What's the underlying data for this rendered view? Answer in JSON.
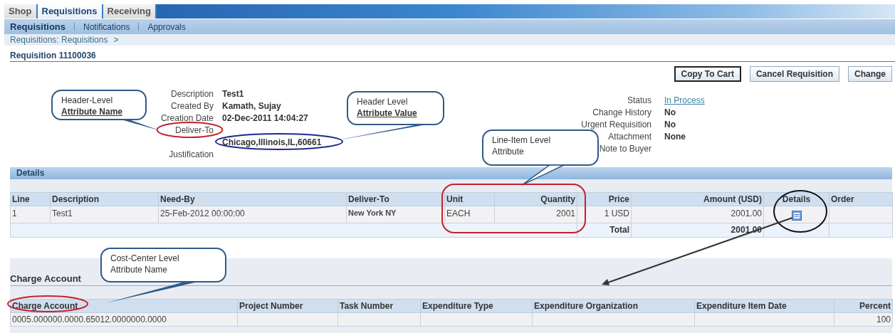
{
  "tabs": [
    {
      "label": "Shop",
      "selected": false
    },
    {
      "label": "Requisitions",
      "selected": true
    },
    {
      "label": "Receiving",
      "selected": false
    }
  ],
  "subtabs": [
    {
      "label": "Requisitions",
      "selected": true
    },
    {
      "label": "Notifications",
      "selected": false
    },
    {
      "label": "Approvals",
      "selected": false
    }
  ],
  "breadcrumb": {
    "link": "Requisitions: Requisitions",
    "separator": ">"
  },
  "title": "Requisition 11100036",
  "buttons": [
    {
      "label": "Copy To Cart",
      "focused": true
    },
    {
      "label": "Cancel Requisition",
      "focused": false
    },
    {
      "label": "Change",
      "focused": false
    }
  ],
  "header_left": [
    {
      "label": "Description",
      "value": "Test1"
    },
    {
      "label": "Created By",
      "value": "Kamath, Sujay"
    },
    {
      "label": "Creation Date",
      "value": "02-Dec-2011 14:04:27"
    },
    {
      "label": "Deliver-To"
    },
    {
      "value": "Chicago,Illinois,IL,60661"
    },
    {
      "label": "Justification"
    }
  ],
  "header_right": [
    {
      "label": "Status",
      "value": "In Process",
      "kind": "link"
    },
    {
      "label": "Change History",
      "value": "No",
      "kind": "text"
    },
    {
      "label": "Urgent Requisition",
      "value": "No",
      "kind": "text"
    },
    {
      "label": "Attachment",
      "value": "None",
      "kind": "text"
    },
    {
      "label": "Note to Buyer"
    }
  ],
  "details": {
    "title": "Details",
    "columns": [
      "Line",
      "Description",
      "Need-By",
      "Deliver-To",
      "Unit",
      "Quantity",
      "Price",
      "Amount (USD)",
      "Details",
      "Order"
    ],
    "rows": [
      {
        "cells": [
          "1",
          "Test1",
          "25-Feb-2012 00:00:00",
          "New York NY",
          "EACH",
          "2001",
          "1 USD",
          "2001.00"
        ]
      }
    ],
    "total_label": "Total",
    "total": "2001.00"
  },
  "charge_account": {
    "title": "Charge Account",
    "columns": [
      "Charge Account",
      "Project Number",
      "Task Number",
      "Expenditure Type",
      "Expenditure Organization",
      "Expenditure Item Date",
      "Percent"
    ],
    "rows": [
      [
        "0005.000000.0000.65012.0000000.0000",
        "",
        "",
        "",
        "",
        "",
        "100"
      ]
    ]
  },
  "callouts": [
    {
      "text": "Header-Level **Attribute Name**"
    },
    {
      "text": "Header Level **Attribute Value**"
    },
    {
      "text": "Line-Item Level Attribute"
    },
    {
      "text": "Cost-Center Level Attribute Name"
    }
  ]
}
